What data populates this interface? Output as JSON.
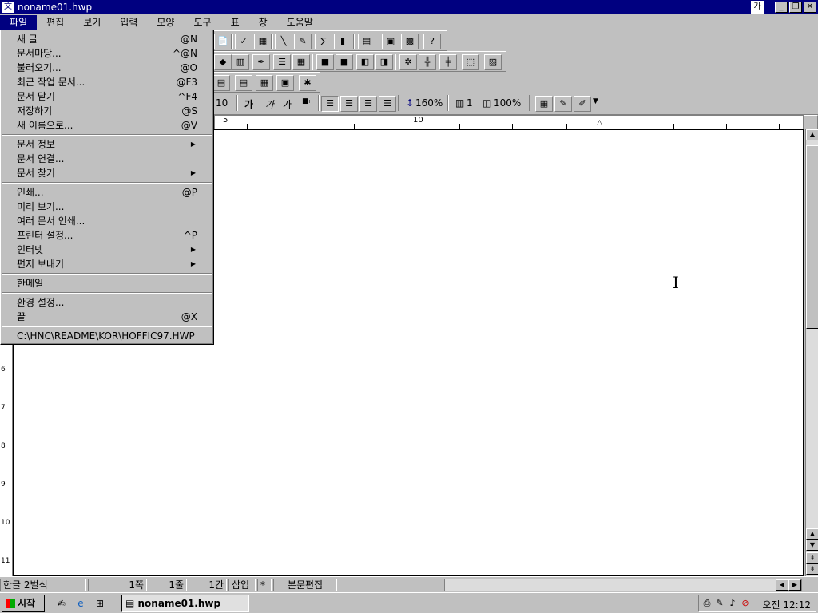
{
  "window": {
    "title": "noname01.hwp",
    "app_icon": "hwp-app-icon",
    "ime_label": "가",
    "controls": [
      "_",
      "❐",
      "✕"
    ]
  },
  "menubar": {
    "items": [
      "파일",
      "편집",
      "보기",
      "입력",
      "모양",
      "도구",
      "표",
      "창",
      "도움말"
    ]
  },
  "file_menu": {
    "groups": [
      [
        {
          "label": "새 글",
          "shortcut": "@N"
        },
        {
          "label": "문서마당...",
          "shortcut": "^@N"
        },
        {
          "label": "불러오기...",
          "shortcut": "@O"
        },
        {
          "label": "최근 작업 문서...",
          "shortcut": "@F3"
        },
        {
          "label": "문서 닫기",
          "shortcut": "^F4"
        },
        {
          "label": "저장하기",
          "shortcut": "@S"
        },
        {
          "label": "새 이름으로...",
          "shortcut": "@V"
        }
      ],
      [
        {
          "label": "문서 정보",
          "submenu": true
        },
        {
          "label": "문서 연결..."
        },
        {
          "label": "문서 찾기",
          "submenu": true
        }
      ],
      [
        {
          "label": "인쇄...",
          "shortcut": "@P"
        },
        {
          "label": "미리 보기..."
        },
        {
          "label": "여러 문서 인쇄..."
        },
        {
          "label": "프린터 설정...",
          "shortcut": "^P"
        },
        {
          "label": "인터넷",
          "submenu": true
        },
        {
          "label": "편지 보내기",
          "submenu": true
        }
      ],
      [
        {
          "label": "한메일"
        }
      ],
      [
        {
          "label": "환경 설정..."
        },
        {
          "label": "끝",
          "shortcut": "@X"
        }
      ],
      [
        {
          "label": "C:\\HNC\\README\\KOR\\HOFFIC97.HWP"
        }
      ]
    ]
  },
  "formatbar": {
    "font_size": "10",
    "bold_label": "가",
    "italic_label": "가",
    "underline_label": "가",
    "line_spacing": "160%",
    "columns": "1",
    "zoom": "100%"
  },
  "ruler": {
    "numbers": [
      "5",
      "10"
    ]
  },
  "vruler": {
    "numbers": [
      "6",
      "7",
      "8",
      "9",
      "10",
      "11"
    ]
  },
  "statusbar": {
    "style": "한글 2벌식",
    "page": "1쪽",
    "line": "1줄",
    "column": "1칸",
    "mode": "삽입",
    "star": "*",
    "edit_mode": "본문편집"
  },
  "taskbar": {
    "start_label": "시작",
    "task_title": "noname01.hwp",
    "clock": "오전 12:12"
  }
}
